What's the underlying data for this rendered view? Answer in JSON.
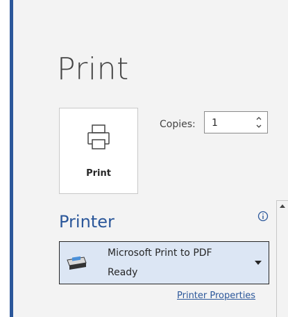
{
  "page": {
    "title": "Print"
  },
  "print_button": {
    "label": "Print",
    "icon": "printer-icon"
  },
  "copies": {
    "label": "Copies:",
    "value": "1"
  },
  "printer_section": {
    "title": "Printer",
    "info_icon": "info-icon",
    "selected_printer": {
      "name": "Microsoft Print to PDF",
      "status": "Ready",
      "icon": "pdf-printer-icon"
    },
    "properties_link": "Printer Properties"
  },
  "colors": {
    "accent": "#2b579a",
    "dropdown_bg": "#dce6f4",
    "background": "#f3f3f3"
  }
}
